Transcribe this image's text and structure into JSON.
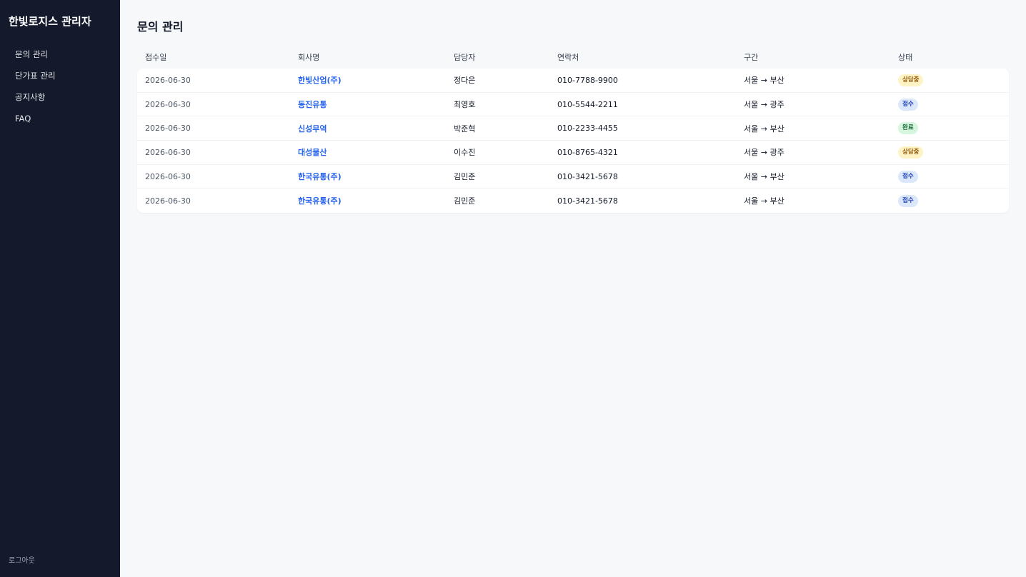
{
  "sidebar": {
    "brand": "한빛로지스 관리자",
    "items": [
      {
        "label": "문의 관리"
      },
      {
        "label": "단가표 관리"
      },
      {
        "label": "공지사항"
      },
      {
        "label": "FAQ"
      }
    ],
    "logout": "로그아웃"
  },
  "main": {
    "title": "문의 관리",
    "table": {
      "headers": {
        "date": "접수일",
        "company": "회사명",
        "person": "담당자",
        "phone": "연락처",
        "route": "구간",
        "status": "상태"
      },
      "rows": [
        {
          "date": "2026-06-30",
          "company": "한빛산업(주)",
          "person": "정다은",
          "phone": "010-7788-9900",
          "route": "서울 → 부산",
          "status": "상담중",
          "status_type": "consult"
        },
        {
          "date": "2026-06-30",
          "company": "동진유통",
          "person": "최영호",
          "phone": "010-5544-2211",
          "route": "서울 → 광주",
          "status": "접수",
          "status_type": "received"
        },
        {
          "date": "2026-06-30",
          "company": "신성무역",
          "person": "박준혁",
          "phone": "010-2233-4455",
          "route": "서울 → 부산",
          "status": "완료",
          "status_type": "done"
        },
        {
          "date": "2026-06-30",
          "company": "대성물산",
          "person": "이수진",
          "phone": "010-8765-4321",
          "route": "서울 → 광주",
          "status": "상담중",
          "status_type": "consult"
        },
        {
          "date": "2026-06-30",
          "company": "한국유통(주)",
          "person": "김민준",
          "phone": "010-3421-5678",
          "route": "서울 → 부산",
          "status": "접수",
          "status_type": "received"
        },
        {
          "date": "2026-06-30",
          "company": "한국유통(주)",
          "person": "김민준",
          "phone": "010-3421-5678",
          "route": "서울 → 부산",
          "status": "접수",
          "status_type": "received"
        }
      ]
    }
  },
  "colors": {
    "sidebar_bg": "#141a2b",
    "page_bg": "#f7f8fa",
    "link": "#2563eb",
    "badge_consult_bg": "#fdf3c4",
    "badge_received_bg": "#dbe7fb",
    "badge_done_bg": "#d5f5df"
  }
}
